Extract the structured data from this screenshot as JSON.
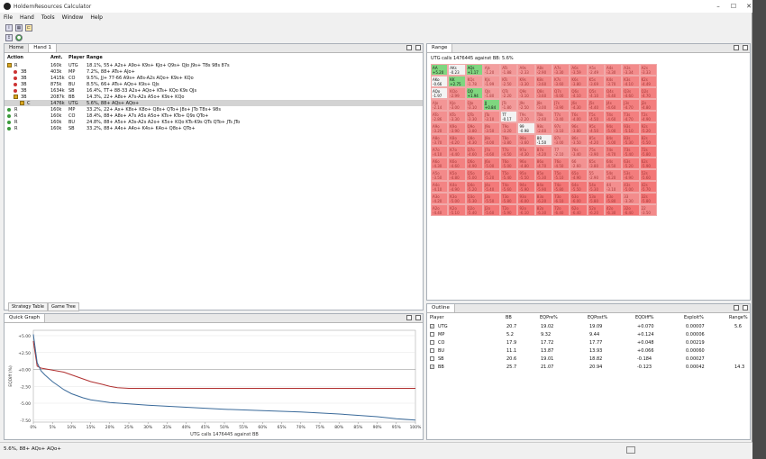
{
  "window": {
    "title": "HoldemResources Calculator"
  },
  "menu": [
    "File",
    "Hand",
    "Tools",
    "Window",
    "Help"
  ],
  "tabs": {
    "home": "Home",
    "hand": "Hand 1"
  },
  "hand_table": {
    "headers": [
      "Action",
      "Amt.",
      "Player",
      "Range"
    ],
    "rows": [
      {
        "action": "R",
        "amt": "160k",
        "player": "UTG",
        "range": "18.1%, 55+ A2s+ A9o+ K9s+ KJo+ Q9s+ QJo J9s+ T8s 98s 87s",
        "indent": 0,
        "icon": "lock",
        "dot": ""
      },
      {
        "action": "3B",
        "amt": "403k",
        "player": "MP",
        "range": "7.2%, 88+ ATs+ AJo+",
        "indent": 1,
        "icon": "dot",
        "dot": "#cc3333"
      },
      {
        "action": "3B",
        "amt": "1415k",
        "player": "CO",
        "range": "9.5%, JJ+ 77-66 A9s+ A8s-A2s AQo+ K9s+ KQo",
        "indent": 1,
        "icon": "dot",
        "dot": "#cc3333"
      },
      {
        "action": "3B",
        "amt": "875k",
        "player": "BU",
        "range": "8.5%, 66+ ATs+ AQo+ K9s+ QJs",
        "indent": 1,
        "icon": "dot",
        "dot": "#cc3333"
      },
      {
        "action": "3B",
        "amt": "1634k",
        "player": "SB",
        "range": "16.4%, TT+ 88-33 A2s+ AQo+ KTs+ KQo K9s QJs",
        "indent": 1,
        "icon": "dot",
        "dot": "#cc3333"
      },
      {
        "action": "3B",
        "amt": "2087k",
        "player": "BB",
        "range": "14.3%, 22+ A8s+ A7s-A2s A5o+ K9s+ KQo",
        "indent": 1,
        "icon": "lock",
        "dot": ""
      },
      {
        "action": "C",
        "amt": "1476k",
        "player": "UTG",
        "range": "5.6%, 88+ AQs+ AQo+",
        "indent": 2,
        "icon": "lock",
        "dot": "",
        "selected": true
      },
      {
        "action": "R",
        "amt": "160k",
        "player": "MP",
        "range": "33.2%, 22+ Ax+ K8s+ K8o+ Q8s+ QTo+ J8s+ JTo T8s+ 98s",
        "indent": 0,
        "icon": "dot",
        "dot": "#3a9a3a"
      },
      {
        "action": "R",
        "amt": "160k",
        "player": "CO",
        "range": "18.4%, 88+ A8s+ A7s A5s A5o+ KTs+ KTo+ Q9s QTo+",
        "indent": 0,
        "icon": "dot",
        "dot": "#3a9a3a"
      },
      {
        "action": "R",
        "amt": "160k",
        "player": "BU",
        "range": "24.8%, 88+ A5s+ A3s-A2s A2o+ K5s+ KQo KTs-K9s QTs QTo+ JTs JTo",
        "indent": 0,
        "icon": "dot",
        "dot": "#3a9a3a"
      },
      {
        "action": "R",
        "amt": "160k",
        "player": "SB",
        "range": "33.2%, 88+ A4s+ A4o+ K4s+ K4o+ Q8s+ QTo+",
        "indent": 0,
        "icon": "dot",
        "dot": "#3a9a3a"
      }
    ]
  },
  "bottom_tabs": [
    "Strategy Table",
    "Game Tree"
  ],
  "quick_graph": {
    "title": "Quick Graph",
    "chart_data": {
      "type": "line",
      "xlabel": "UTG calls 1476445 against BB",
      "ylabel": "EQDiff (%)",
      "yticks": [
        "+5.00",
        "+2.50",
        "+0.00",
        "-2.50",
        "-5.00",
        "-7.50"
      ],
      "yvalues": [
        5,
        2.5,
        0,
        -2.5,
        -5,
        -7.5
      ],
      "xticks": [
        "0%",
        "5%",
        "10%",
        "15%",
        "20%",
        "25%",
        "30%",
        "35%",
        "40%",
        "45%",
        "50%",
        "55%",
        "60%",
        "65%",
        "70%",
        "75%",
        "80%",
        "85%",
        "90%",
        "95%",
        "100%"
      ],
      "ylim": [
        -7.8,
        5.8
      ],
      "series": [
        {
          "color": "#b03030",
          "x": [
            0,
            1,
            2,
            3,
            5,
            8,
            10,
            13,
            15,
            18,
            20,
            22,
            25,
            100
          ],
          "y": [
            4.2,
            0.5,
            0.2,
            0.1,
            -0.1,
            -0.4,
            -0.8,
            -1.4,
            -1.8,
            -2.2,
            -2.5,
            -2.7,
            -2.8,
            -2.8
          ]
        },
        {
          "color": "#3a6a9a",
          "x": [
            0,
            1,
            2,
            3,
            5,
            8,
            10,
            13,
            15,
            20,
            25,
            30,
            40,
            50,
            60,
            70,
            80,
            90,
            95,
            100
          ],
          "y": [
            5.2,
            1.0,
            -0.2,
            -0.8,
            -1.8,
            -3.0,
            -3.6,
            -4.2,
            -4.5,
            -4.9,
            -5.1,
            -5.3,
            -5.6,
            -5.9,
            -6.1,
            -6.3,
            -6.6,
            -7.0,
            -7.3,
            -7.5
          ]
        }
      ]
    }
  },
  "range_panel": {
    "title": "Range",
    "subtitle": "UTG calls 1476445 against BB: 5.6%",
    "grid": [
      [
        [
          "AA",
          "+5.20",
          1
        ],
        [
          "AKs",
          "-0.23",
          1
        ],
        [
          "AQs",
          "+1.17",
          1
        ],
        [
          "AJs",
          "-1.20",
          0
        ],
        [
          "ATs",
          "-1.88",
          0
        ],
        [
          "A9s",
          "-2.33",
          0
        ],
        [
          "A8s",
          "-2.90",
          0
        ],
        [
          "A7s",
          "-3.30",
          0
        ],
        [
          "A6s",
          "-3.59",
          0
        ],
        [
          "A5s",
          "-2.49",
          0
        ],
        [
          "A4s",
          "-3.30",
          0
        ],
        [
          "A3s",
          "-3.34",
          0
        ],
        [
          "A2s",
          "-3.33",
          0
        ]
      ],
      [
        [
          "AKo",
          "-0.66",
          1
        ],
        [
          "KK",
          "+2.75",
          1
        ],
        [
          "KQs",
          "-1.78",
          0
        ],
        [
          "KJs",
          "-1.99",
          0
        ],
        [
          "KTs",
          "-2.50",
          0
        ],
        [
          "K9s",
          "-3.30",
          0
        ],
        [
          "K8s",
          "-3.60",
          0
        ],
        [
          "K7s",
          "-3.60",
          0
        ],
        [
          "K6s",
          "-3.80",
          0
        ],
        [
          "K5s",
          "-3.69",
          0
        ],
        [
          "K4s",
          "-3.70",
          0
        ],
        [
          "K3s",
          "-4.10",
          0
        ],
        [
          "K2s",
          "-4.49",
          0
        ]
      ],
      [
        [
          "AQo",
          "-1.97",
          1
        ],
        [
          "KQo",
          "-2.99",
          0
        ],
        [
          "QQ",
          "+1.94",
          1
        ],
        [
          "QJs",
          "-1.80",
          0
        ],
        [
          "QTs",
          "-2.20",
          0
        ],
        [
          "Q9s",
          "-3.10",
          0
        ],
        [
          "Q8s",
          "-3.60",
          0
        ],
        [
          "Q7s",
          "-4.00",
          0
        ],
        [
          "Q6s",
          "-4.10",
          0
        ],
        [
          "Q5s",
          "-4.10",
          0
        ],
        [
          "Q4s",
          "-4.40",
          0
        ],
        [
          "Q3s",
          "-4.60",
          0
        ],
        [
          "Q2s",
          "-4.70",
          0
        ]
      ],
      [
        [
          "AJo",
          "-2.14",
          0
        ],
        [
          "KJo",
          "-3.00",
          0
        ],
        [
          "QJo",
          "-3.10",
          0
        ],
        [
          "JJ",
          "+0.84",
          1
        ],
        [
          "JTs",
          "-1.80",
          0
        ],
        [
          "J9s",
          "-2.50",
          0
        ],
        [
          "J8s",
          "-3.00",
          0
        ],
        [
          "J7s",
          "-3.90",
          0
        ],
        [
          "J6s",
          "-4.30",
          0
        ],
        [
          "J5s",
          "-4.40",
          0
        ],
        [
          "J4s",
          "-4.60",
          0
        ],
        [
          "J3s",
          "-4.70",
          0
        ],
        [
          "J2s",
          "-4.80",
          0
        ]
      ],
      [
        [
          "ATo",
          "-2.86",
          0
        ],
        [
          "KTo",
          "-3.30",
          0
        ],
        [
          "QTo",
          "-3.30",
          0
        ],
        [
          "JTo",
          "-3.10",
          0
        ],
        [
          "TT",
          "-0.17",
          1
        ],
        [
          "T9s",
          "-2.20",
          0
        ],
        [
          "T8s",
          "-2.60",
          0
        ],
        [
          "T7s",
          "-3.40",
          0
        ],
        [
          "T6s",
          "-4.00",
          0
        ],
        [
          "T5s",
          "-4.50",
          0
        ],
        [
          "T4s",
          "-4.60",
          0
        ],
        [
          "T3s",
          "-4.70",
          0
        ],
        [
          "T2s",
          "-4.90",
          0
        ]
      ],
      [
        [
          "A9o",
          "-3.20",
          0
        ],
        [
          "K9o",
          "-3.90",
          0
        ],
        [
          "Q9o",
          "-3.80",
          0
        ],
        [
          "J9o",
          "-3.50",
          0
        ],
        [
          "T9o",
          "-3.20",
          0
        ],
        [
          "99",
          "-0.98",
          1
        ],
        [
          "98s",
          "-2.60",
          0
        ],
        [
          "97s",
          "-3.10",
          0
        ],
        [
          "96s",
          "-3.80",
          0
        ],
        [
          "95s",
          "-4.50",
          0
        ],
        [
          "94s",
          "-5.00",
          0
        ],
        [
          "93s",
          "-5.10",
          0
        ],
        [
          "92s",
          "-5.20",
          0
        ]
      ],
      [
        [
          "A8o",
          "-3.70",
          0
        ],
        [
          "K8o",
          "-4.20",
          0
        ],
        [
          "Q8o",
          "-4.30",
          0
        ],
        [
          "J8o",
          "-4.00",
          0
        ],
        [
          "T8o",
          "-3.80",
          0
        ],
        [
          "98o",
          "-3.60",
          0
        ],
        [
          "88",
          "-1.50",
          1
        ],
        [
          "87s",
          "-3.00",
          0
        ],
        [
          "86s",
          "-3.50",
          0
        ],
        [
          "85s",
          "-4.20",
          0
        ],
        [
          "84s",
          "-5.00",
          0
        ],
        [
          "83s",
          "-5.30",
          0
        ],
        [
          "82s",
          "-5.50",
          0
        ]
      ],
      [
        [
          "A7o",
          "-4.10",
          0
        ],
        [
          "K7o",
          "-4.40",
          0
        ],
        [
          "Q7o",
          "-4.60",
          0
        ],
        [
          "J7o",
          "-4.60",
          0
        ],
        [
          "T7o",
          "-4.50",
          0
        ],
        [
          "97o",
          "-4.30",
          0
        ],
        [
          "87o",
          "-4.20",
          0
        ],
        [
          "77",
          "-2.10",
          0
        ],
        [
          "76s",
          "-3.40",
          0
        ],
        [
          "75s",
          "-3.90",
          0
        ],
        [
          "74s",
          "-4.70",
          0
        ],
        [
          "73s",
          "-5.40",
          0
        ],
        [
          "72s",
          "-5.80",
          0
        ]
      ],
      [
        [
          "A6o",
          "-4.30",
          0
        ],
        [
          "K6o",
          "-4.60",
          0
        ],
        [
          "Q6o",
          "-4.90",
          0
        ],
        [
          "J6o",
          "-5.00",
          0
        ],
        [
          "T6o",
          "-5.00",
          0
        ],
        [
          "96o",
          "-4.80",
          0
        ],
        [
          "86o",
          "-4.70",
          0
        ],
        [
          "76o",
          "-4.50",
          0
        ],
        [
          "66",
          "-2.60",
          0
        ],
        [
          "65s",
          "-3.80",
          0
        ],
        [
          "64s",
          "-4.50",
          0
        ],
        [
          "63s",
          "-5.20",
          0
        ],
        [
          "62s",
          "-5.90",
          0
        ]
      ],
      [
        [
          "A5o",
          "-3.50",
          0
        ],
        [
          "K5o",
          "-4.80",
          0
        ],
        [
          "Q5o",
          "-5.00",
          0
        ],
        [
          "J5o",
          "-5.20",
          0
        ],
        [
          "T5o",
          "-5.40",
          0
        ],
        [
          "95o",
          "-5.50",
          0
        ],
        [
          "85o",
          "-5.30",
          0
        ],
        [
          "75o",
          "-5.10",
          0
        ],
        [
          "65o",
          "-4.90",
          0
        ],
        [
          "55",
          "-2.90",
          0
        ],
        [
          "54s",
          "-4.20",
          0
        ],
        [
          "53s",
          "-4.90",
          0
        ],
        [
          "52s",
          "-5.60",
          0
        ]
      ],
      [
        [
          "A4o",
          "-4.10",
          0
        ],
        [
          "K4o",
          "-4.90",
          0
        ],
        [
          "Q4o",
          "-5.20",
          0
        ],
        [
          "J4o",
          "-5.40",
          0
        ],
        [
          "T4o",
          "-5.60",
          0
        ],
        [
          "94o",
          "-5.90",
          0
        ],
        [
          "84o",
          "-5.90",
          0
        ],
        [
          "74o",
          "-5.80",
          0
        ],
        [
          "64o",
          "-5.50",
          0
        ],
        [
          "54o",
          "-5.30",
          0
        ],
        [
          "44",
          "-3.10",
          0
        ],
        [
          "43s",
          "-5.00",
          0
        ],
        [
          "42s",
          "-5.70",
          0
        ]
      ],
      [
        [
          "A3o",
          "-4.20",
          0
        ],
        [
          "K3o",
          "-5.00",
          0
        ],
        [
          "Q3o",
          "-5.30",
          0
        ],
        [
          "J3o",
          "-5.50",
          0
        ],
        [
          "T3o",
          "-5.80",
          0
        ],
        [
          "93o",
          "-6.00",
          0
        ],
        [
          "83o",
          "-6.20",
          0
        ],
        [
          "73o",
          "-6.10",
          0
        ],
        [
          "63o",
          "-6.00",
          0
        ],
        [
          "53o",
          "-5.80",
          0
        ],
        [
          "43o",
          "-5.80",
          0
        ],
        [
          "33",
          "-3.30",
          0
        ],
        [
          "32s",
          "-5.80",
          0
        ]
      ],
      [
        [
          "A2o",
          "-4.40",
          0
        ],
        [
          "K2o",
          "-5.10",
          0
        ],
        [
          "Q2o",
          "-5.40",
          0
        ],
        [
          "J2o",
          "-5.60",
          0
        ],
        [
          "T2o",
          "-5.90",
          0
        ],
        [
          "92o",
          "-6.10",
          0
        ],
        [
          "82o",
          "-6.30",
          0
        ],
        [
          "72o",
          "-6.40",
          0
        ],
        [
          "62o",
          "-6.40",
          0
        ],
        [
          "52o",
          "-6.20",
          0
        ],
        [
          "42o",
          "-6.30",
          0
        ],
        [
          "32o",
          "-6.40",
          0
        ],
        [
          "22",
          "-3.50",
          0
        ]
      ]
    ]
  },
  "outline": {
    "title": "Outline",
    "headers": [
      "Player",
      "BB",
      "EQPre%",
      "EQPost%",
      "EQDiff%",
      "Exploit%",
      "Range%"
    ],
    "rows": [
      {
        "player": "UTG",
        "bb": "20.7",
        "eqpre": "19.02",
        "eqpost": "19.09",
        "eqdiff": "+0.070",
        "exploit": "0.00007",
        "range": "5.6",
        "checked": true
      },
      {
        "player": "MP",
        "bb": "5.2",
        "eqpre": "9.32",
        "eqpost": "9.44",
        "eqdiff": "+0.124",
        "exploit": "0.00006",
        "range": "",
        "checked": false
      },
      {
        "player": "CO",
        "bb": "17.9",
        "eqpre": "17.72",
        "eqpost": "17.77",
        "eqdiff": "+0.048",
        "exploit": "0.00219",
        "range": "",
        "checked": false
      },
      {
        "player": "BU",
        "bb": "11.1",
        "eqpre": "13.87",
        "eqpost": "13.93",
        "eqdiff": "+0.066",
        "exploit": "0.00060",
        "range": "",
        "checked": false
      },
      {
        "player": "SB",
        "bb": "20.6",
        "eqpre": "19.01",
        "eqpost": "18.82",
        "eqdiff": "-0.184",
        "exploit": "0.00027",
        "range": "",
        "checked": false
      },
      {
        "player": "BB",
        "bb": "25.7",
        "eqpre": "21.07",
        "eqpost": "20.94",
        "eqdiff": "-0.123",
        "exploit": "0.00042",
        "range": "14.3",
        "checked": true
      }
    ]
  },
  "status": {
    "text": "5.6%, 88+ AQs+ AQo+"
  },
  "colors": {
    "green": "#7fd67f",
    "red": "#f08a8a",
    "accent": "#3a6a9a"
  }
}
